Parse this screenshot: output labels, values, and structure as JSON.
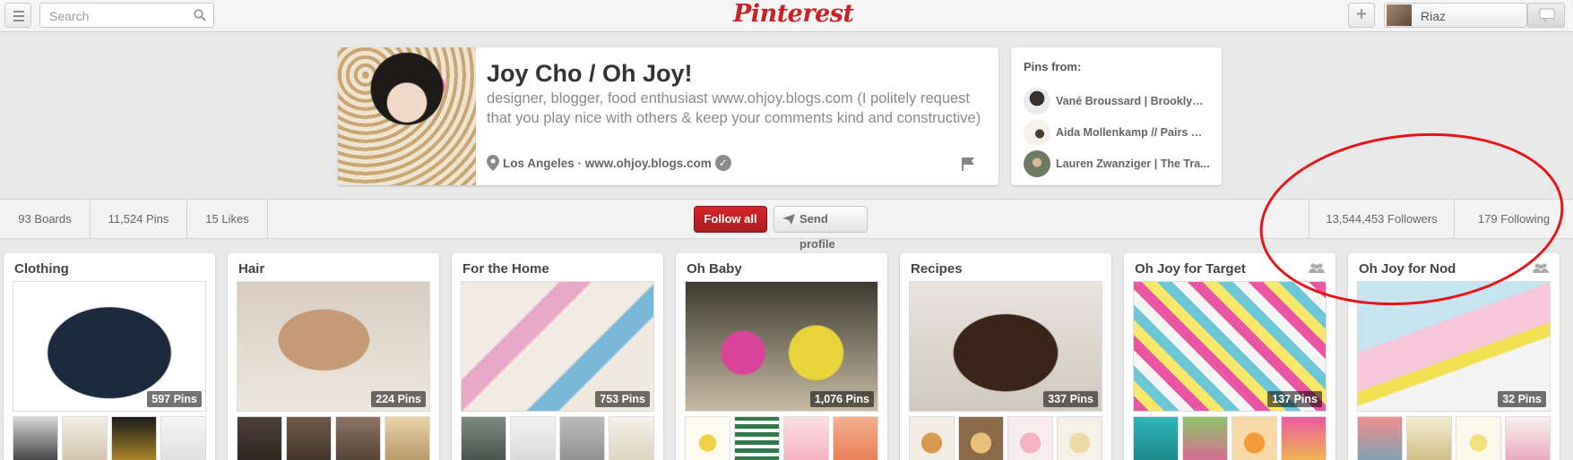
{
  "header": {
    "search_placeholder": "Search",
    "logo": "Pinterest",
    "user_name": "Riaz"
  },
  "profile": {
    "name": "Joy Cho / Oh Joy!",
    "bio": "designer, blogger, food enthusiast www.ohjoy.blogs.com (I politely request that you play nice with others & keep your comments kind and constructive)",
    "location": "Los Angeles · www.ohjoy.blogs.com"
  },
  "pins_from": {
    "title": "Pins from:",
    "items": [
      {
        "name": "Vané Broussard | Brooklyn ..."
      },
      {
        "name": "Aida Mollenkamp // Pairs W..."
      },
      {
        "name": "Lauren Zwanziger | The Tra..."
      }
    ]
  },
  "stats": {
    "boards": "93 Boards",
    "pins": "11,524 Pins",
    "likes": "15 Likes",
    "followers": "13,544,453 Followers",
    "following": "179 Following"
  },
  "actions": {
    "follow_all": "Follow all",
    "send_profile": "Send profile"
  },
  "boards": [
    {
      "title": "Clothing",
      "count": "597 Pins"
    },
    {
      "title": "Hair",
      "count": "224 Pins"
    },
    {
      "title": "For the Home",
      "count": "753 Pins"
    },
    {
      "title": "Oh Baby",
      "count": "1,076 Pins"
    },
    {
      "title": "Recipes",
      "count": "337 Pins"
    },
    {
      "title": "Oh Joy for Target",
      "count": "137 Pins"
    },
    {
      "title": "Oh Joy for Nod",
      "count": "32 Pins"
    }
  ],
  "colors": {
    "brand_red": "#cb2027",
    "annotation_red": "#e8141a",
    "background": "#e9e9e9"
  }
}
